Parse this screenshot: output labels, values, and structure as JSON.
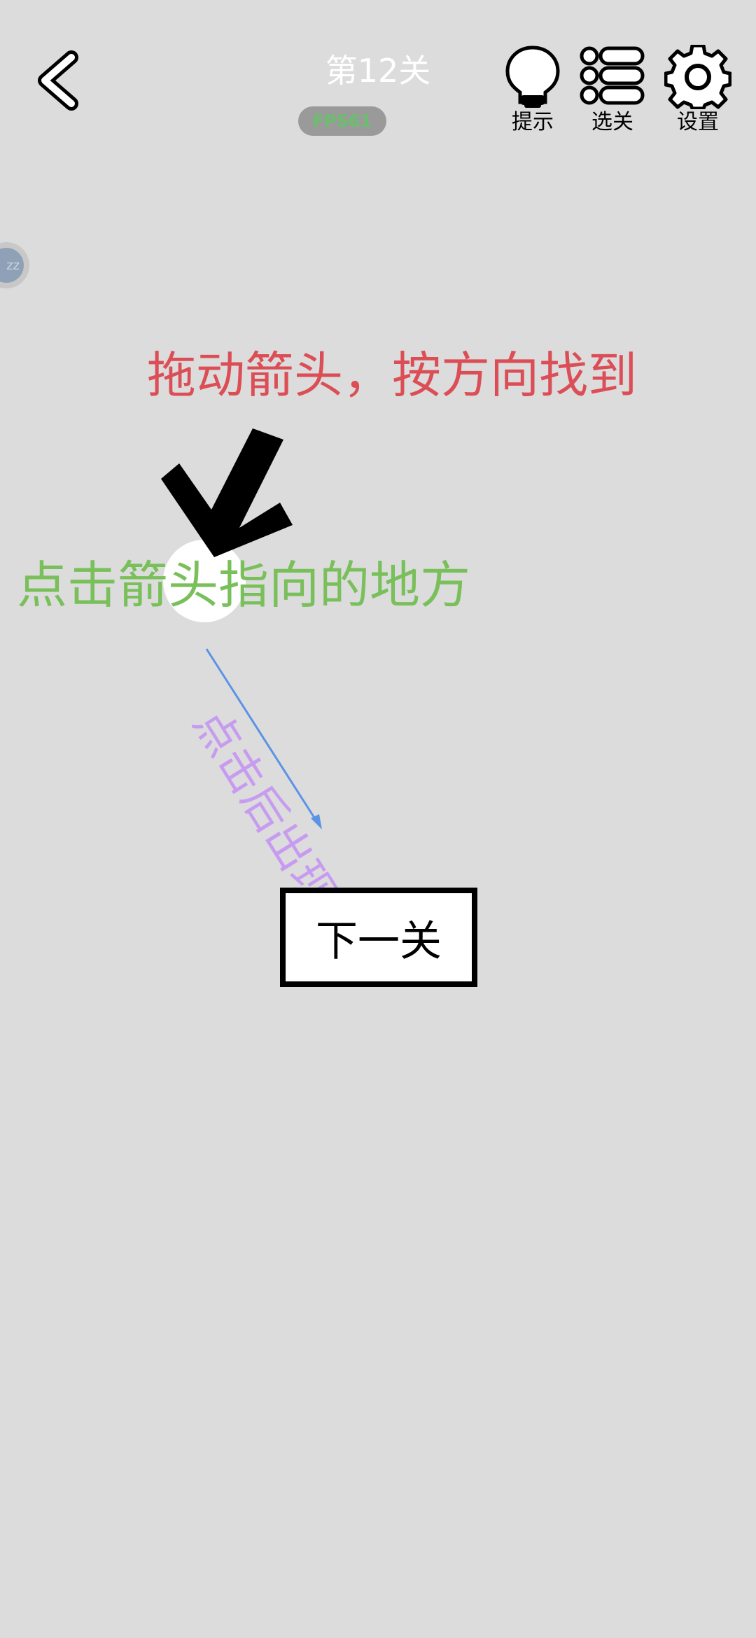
{
  "header": {
    "level_title": "第12关",
    "fps_badge": "FPS61",
    "hint_label": "提示",
    "level_select_label": "选关",
    "settings_label": "设置"
  },
  "side_float": {
    "text": "zz"
  },
  "puzzle": {
    "red_instruction": "拖动箭头，按方向找到",
    "green_instruction": "点击箭头指向的地方",
    "purple_note": "点击后出现",
    "next_button": "下一关"
  },
  "icons": {
    "back": "chevron-left-icon",
    "hint": "lightbulb-icon",
    "level_select": "list-icon",
    "settings": "gear-icon",
    "drag_arrow": "black-arrow-icon",
    "pointer_arrow": "blue-arrow-icon"
  },
  "colors": {
    "background": "#dcdcdc",
    "red_text": "#dc4e56",
    "green_text": "#79bf5a",
    "purple_text": "#c79cf0",
    "blue_arrow": "#5b93e6"
  }
}
